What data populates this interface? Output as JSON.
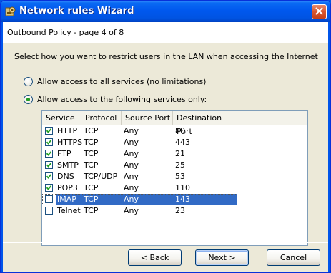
{
  "window": {
    "title": "Network rules Wizard",
    "app_icon": "wizard-gear-icon",
    "close_icon": "close-x-icon"
  },
  "header": {
    "page_title": "Outbound Policy - page 4 of 8"
  },
  "instruction": "Select how you want to restrict users in the LAN when accessing the Internet",
  "options": [
    {
      "label": "Allow access to all services (no limitations)",
      "selected": false
    },
    {
      "label": "Allow access to the following services only:",
      "selected": true
    }
  ],
  "services_table": {
    "columns": [
      "Service",
      "Protocol",
      "Source Port",
      "Destination Port"
    ],
    "rows": [
      {
        "service": "HTTP",
        "protocol": "TCP",
        "source_port": "Any",
        "destination_port": "80",
        "checked": true,
        "selected": false
      },
      {
        "service": "HTTPS",
        "protocol": "TCP",
        "source_port": "Any",
        "destination_port": "443",
        "checked": true,
        "selected": false
      },
      {
        "service": "FTP",
        "protocol": "TCP",
        "source_port": "Any",
        "destination_port": "21",
        "checked": true,
        "selected": false
      },
      {
        "service": "SMTP",
        "protocol": "TCP",
        "source_port": "Any",
        "destination_port": "25",
        "checked": true,
        "selected": false
      },
      {
        "service": "DNS",
        "protocol": "TCP/UDP",
        "source_port": "Any",
        "destination_port": "53",
        "checked": true,
        "selected": false
      },
      {
        "service": "POP3",
        "protocol": "TCP",
        "source_port": "Any",
        "destination_port": "110",
        "checked": true,
        "selected": false
      },
      {
        "service": "IMAP",
        "protocol": "TCP",
        "source_port": "Any",
        "destination_port": "143",
        "checked": false,
        "selected": true
      },
      {
        "service": "Telnet",
        "protocol": "TCP",
        "source_port": "Any",
        "destination_port": "23",
        "checked": false,
        "selected": false
      }
    ]
  },
  "buttons": {
    "back": "< Back",
    "next": "Next >",
    "cancel": "Cancel"
  },
  "colors": {
    "titlebar": "#0054e3",
    "selection": "#316ac5",
    "dialog_bg": "#ece9d8"
  }
}
